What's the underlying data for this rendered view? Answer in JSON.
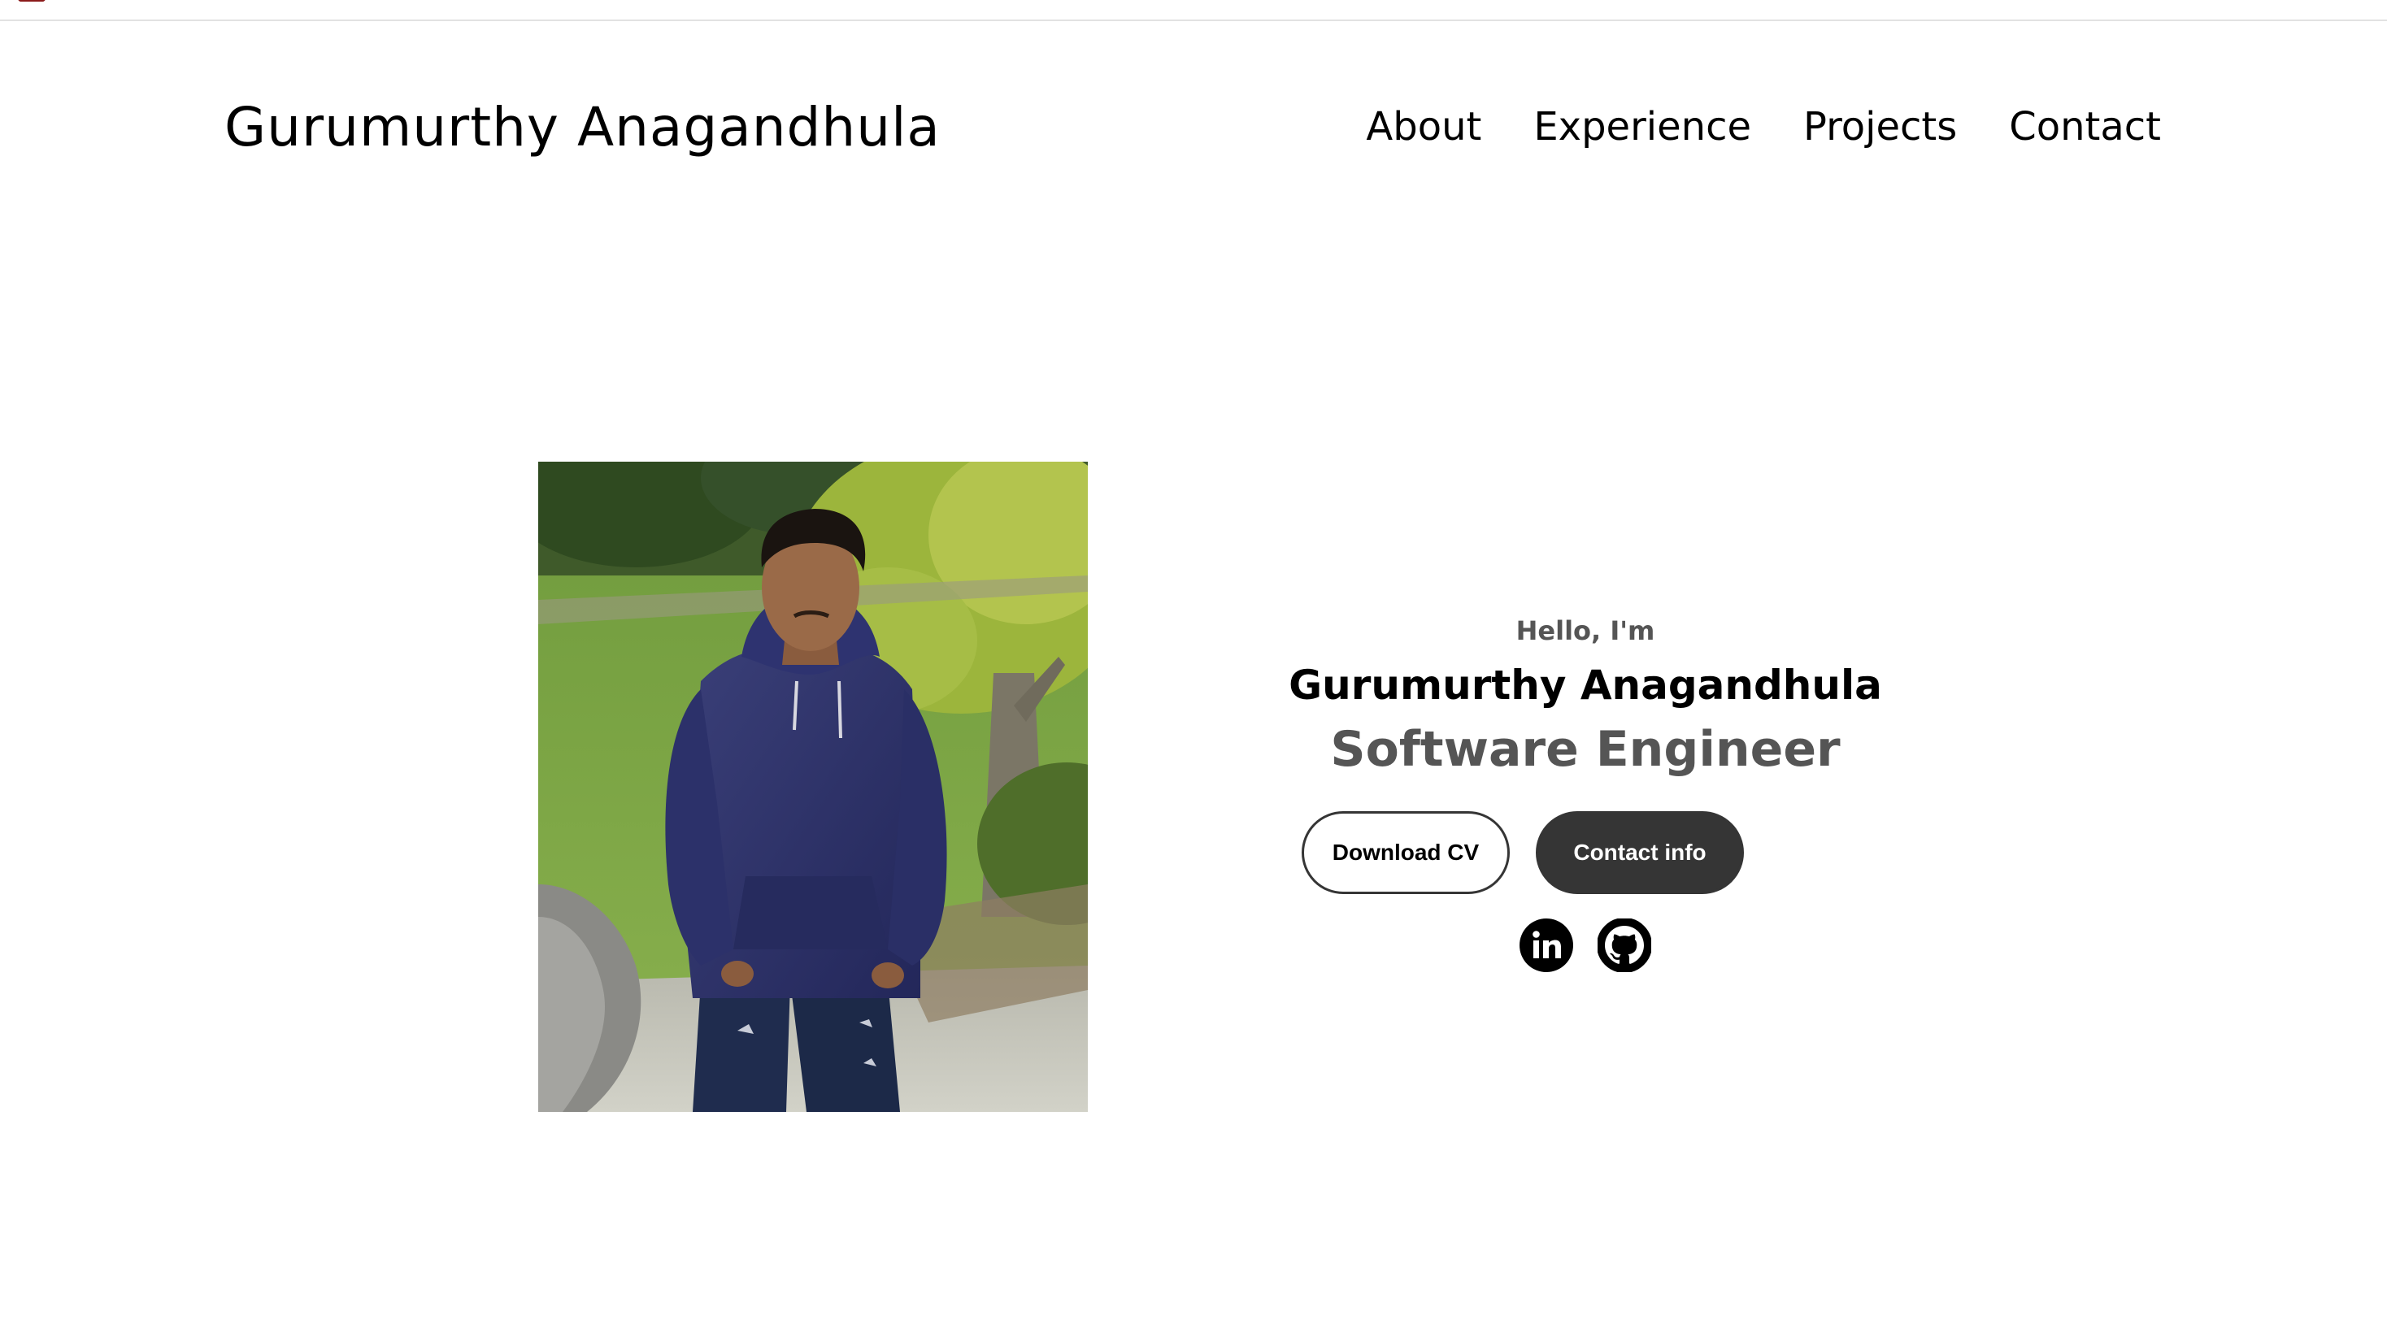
{
  "header": {
    "logo_text": "Gurumurthy Anagandhula",
    "nav": [
      {
        "label": "About"
      },
      {
        "label": "Experience"
      },
      {
        "label": "Projects"
      },
      {
        "label": "Contact"
      }
    ]
  },
  "hero": {
    "greeting": "Hello, I'm",
    "name": "Gurumurthy Anagandhula",
    "title": "Software Engineer",
    "buttons": {
      "download_cv": "Download CV",
      "contact_info": "Contact info"
    },
    "social": [
      {
        "icon": "linkedin-icon"
      },
      {
        "icon": "github-icon"
      }
    ]
  },
  "colors": {
    "primary_text": "#000000",
    "muted_text": "#555555",
    "button_dark": "#353535",
    "background": "#ffffff"
  }
}
